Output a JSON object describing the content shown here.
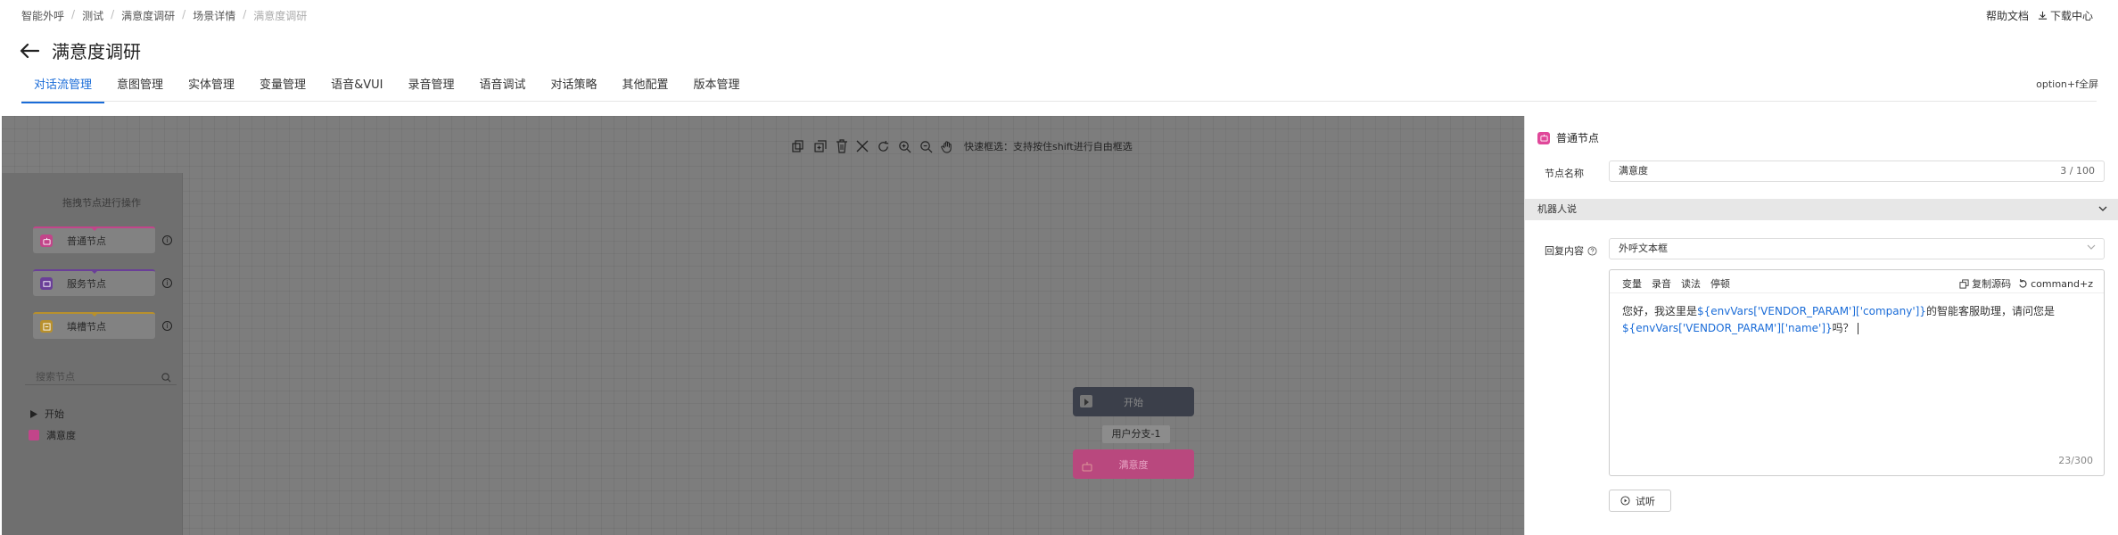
{
  "breadcrumb": [
    "智能外呼",
    "测试",
    "满意度调研",
    "场景详情",
    "满意度调研"
  ],
  "top_links": {
    "help": "帮助文档",
    "download": "下载中心"
  },
  "page_title": "满意度调研",
  "tabs": [
    {
      "label": "对话流管理",
      "active": true
    },
    {
      "label": "意图管理"
    },
    {
      "label": "实体管理"
    },
    {
      "label": "变量管理"
    },
    {
      "label": "语音&VUI"
    },
    {
      "label": "录音管理"
    },
    {
      "label": "语音调试"
    },
    {
      "label": "对话策略"
    },
    {
      "label": "其他配置"
    },
    {
      "label": "版本管理"
    }
  ],
  "fullscreen_hint": "option+f全屏",
  "toolbar": {
    "tip": "快速框选：支持按住shift进行自由框选"
  },
  "left_panel": {
    "hint": "拖拽节点进行操作",
    "nodes": [
      {
        "label": "普通节点",
        "color": "#c2458a"
      },
      {
        "label": "服务节点",
        "color": "#6a3f98"
      },
      {
        "label": "填槽节点",
        "color": "#b8902c"
      }
    ],
    "search_placeholder": "搜索节点",
    "tree": [
      {
        "label": "开始"
      },
      {
        "label": "满意度"
      }
    ]
  },
  "flow": {
    "start_label": "开始",
    "branch_label": "用户分支-1",
    "node_label": "满意度"
  },
  "right_panel": {
    "title": "普通节点",
    "name_label": "节点名称",
    "name_value": "满意度",
    "name_count": "3 / 100",
    "section": "机器人说",
    "reply_label": "回复内容",
    "reply_type": "外呼文本框",
    "editor_tools": [
      "变量",
      "录音",
      "读法",
      "停顿"
    ],
    "copy_source": "复制源码",
    "undo_hint": "command+z",
    "content": {
      "t1": "您好，我这里是",
      "v1": "${envVars['VENDOR_PARAM']['company']}",
      "t2": "的智能客服助理，请问您是",
      "v2": "${envVars['VENDOR_PARAM']['name']}",
      "t3": "吗？"
    },
    "char_count": "23/300",
    "listen_label": "试听"
  },
  "colors": {
    "accent": "#1a6cd8",
    "pink": "#e0489a",
    "start_node": "#3b3f4a"
  }
}
